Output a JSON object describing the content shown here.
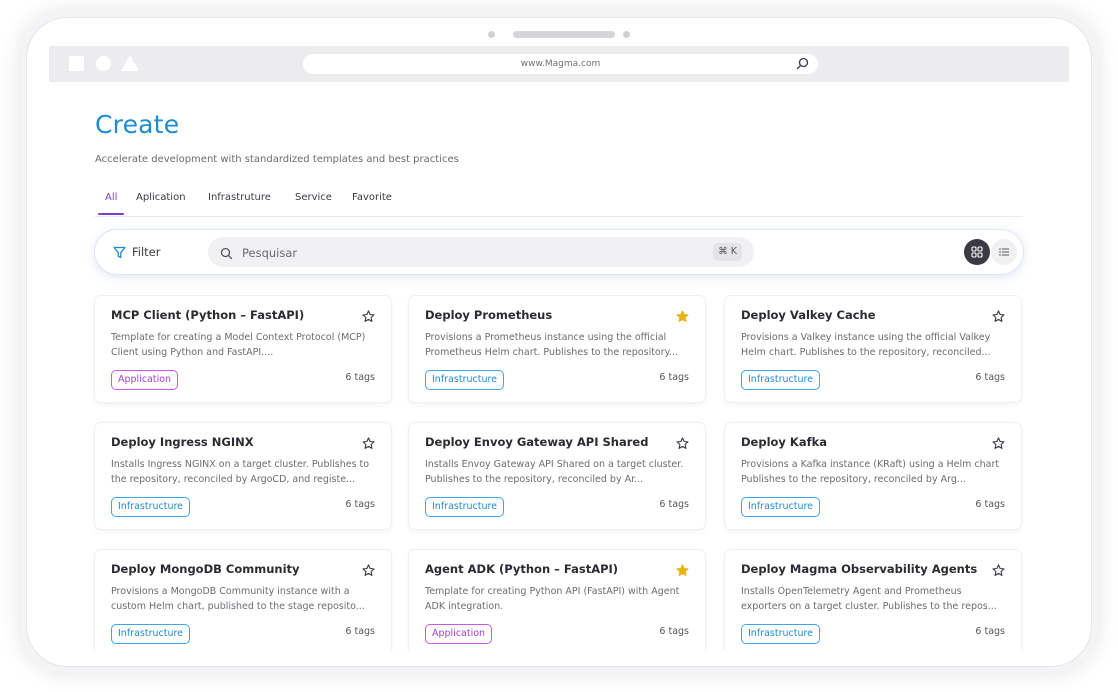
{
  "browser": {
    "url": "www.Magma.com"
  },
  "page": {
    "title": "Create",
    "subtitle": "Accelerate development with standardized templates and best practices"
  },
  "tabs": [
    {
      "label": "All",
      "active": true
    },
    {
      "label": "Aplication",
      "active": false
    },
    {
      "label": "Infrastruture",
      "active": false
    },
    {
      "label": "Service",
      "active": false
    },
    {
      "label": "Favorite",
      "active": false
    }
  ],
  "toolbar": {
    "filter_label": "Filter",
    "search_placeholder": "Pesquisar",
    "shortcut": "⌘ K"
  },
  "colors": {
    "accent": "#1f8bd0",
    "tab_active": "#7a3fd1",
    "application_badge": "#a53ed6",
    "infrastructure_badge": "#1f8bd0",
    "star_favorite": "#e8b319"
  },
  "cards": [
    {
      "title": "MCP Client (Python – FastAPI)",
      "description": "Template for creating a Model Context Protocol (MCP) Client using Python and FastAPI....",
      "badge": "Application",
      "tags": "6 tags",
      "favorite": false
    },
    {
      "title": "Deploy Prometheus",
      "description": "Provisions a Prometheus instance using the official Prometheus Helm chart. Publishes to the repository...",
      "badge": "Infrastructure",
      "tags": "6 tags",
      "favorite": true
    },
    {
      "title": "Deploy Valkey Cache",
      "description": "Provisions a Valkey instance using the official Valkey Helm chart. Publishes to the repository, reconciled...",
      "badge": "Infrastructure",
      "tags": "6 tags",
      "favorite": false
    },
    {
      "title": "Deploy Ingress NGINX",
      "description": "Installs Ingress NGINX on a target cluster. Publishes to the repository, reconciled by ArgoCD, and registe...",
      "badge": "Infrastructure",
      "tags": "6 tags",
      "favorite": false
    },
    {
      "title": "Deploy Envoy Gateway API Shared",
      "description": "Installs Envoy Gateway API Shared on a target cluster. Publishes to the repository, reconciled by Ar...",
      "badge": "Infrastructure",
      "tags": "6 tags",
      "favorite": false
    },
    {
      "title": "Deploy Kafka",
      "description": "Provisions a Kafka instance (KRaft) using a Helm chart Publishes to the repository, reconciled by Arg...",
      "badge": "Infrastructure",
      "tags": "6 tags",
      "favorite": false
    },
    {
      "title": "Deploy MongoDB Community",
      "description": "Provisions a MongoDB Community instance with a custom Helm chart, published to the stage reposito...",
      "badge": "Infrastructure",
      "tags": "6 tags",
      "favorite": false
    },
    {
      "title": "Agent ADK (Python – FastAPI)",
      "description": "Template for creating Python API (FastAPI) with Agent ADK integration.",
      "badge": "Application",
      "tags": "6 tags",
      "favorite": true
    },
    {
      "title": "Deploy Magma Observability Agents",
      "description": "Installs OpenTelemetry Agent and Prometheus exporters on a target cluster. Publishes to the repos...",
      "badge": "Infrastructure",
      "tags": "6 tags",
      "favorite": false
    }
  ]
}
